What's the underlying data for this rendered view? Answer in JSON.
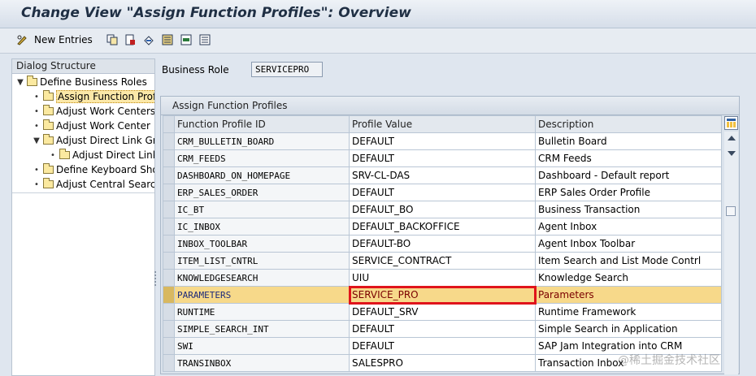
{
  "window": {
    "title": "Change View \"Assign Function Profiles\": Overview"
  },
  "toolbar": {
    "new_entries_label": "New Entries"
  },
  "dialog_structure": {
    "header": "Dialog Structure",
    "items": [
      {
        "label": "Define Business Roles",
        "level": 0,
        "expanded": true
      },
      {
        "label": "Assign Function Profi",
        "level": 1,
        "selected": true
      },
      {
        "label": "Adjust Work Centers",
        "level": 1
      },
      {
        "label": "Adjust Work Center",
        "level": 1
      },
      {
        "label": "Adjust Direct Link Gr",
        "level": 1,
        "expanded": true
      },
      {
        "label": "Adjust Direct Link",
        "level": 2
      },
      {
        "label": "Define Keyboard Sho",
        "level": 1
      },
      {
        "label": "Adjust Central Search",
        "level": 1
      }
    ]
  },
  "business_role": {
    "label": "Business Role",
    "value": "SERVICEPRO"
  },
  "table": {
    "title": "Assign Function Profiles",
    "columns": [
      "Function Profile ID",
      "Profile Value",
      "Description"
    ],
    "rows": [
      {
        "id": "CRM_BULLETIN_BOARD",
        "value": "DEFAULT",
        "description": "Bulletin Board"
      },
      {
        "id": "CRM_FEEDS",
        "value": "DEFAULT",
        "description": "CRM Feeds"
      },
      {
        "id": "DASHBOARD_ON_HOMEPAGE",
        "value": "SRV-CL-DAS",
        "description": "Dashboard - Default report"
      },
      {
        "id": "ERP_SALES_ORDER",
        "value": "DEFAULT",
        "description": "ERP Sales Order Profile"
      },
      {
        "id": "IC_BT",
        "value": "DEFAULT_BO",
        "description": "Business Transaction"
      },
      {
        "id": "IC_INBOX",
        "value": "DEFAULT_BACKOFFICE",
        "description": "Agent Inbox"
      },
      {
        "id": "INBOX_TOOLBAR",
        "value": "DEFAULT-BO",
        "description": "Agent Inbox Toolbar"
      },
      {
        "id": "ITEM_LIST_CNTRL",
        "value": "SERVICE_CONTRACT",
        "description": "Item Search and List Mode Contrl"
      },
      {
        "id": "KNOWLEDGESEARCH",
        "value": "UIU",
        "description": "Knowledge Search"
      },
      {
        "id": "PARAMETERS",
        "value": "SERVICE_PRO",
        "description": "Parameters",
        "highlighted": true
      },
      {
        "id": "RUNTIME",
        "value": "DEFAULT_SRV",
        "description": "Runtime Framework"
      },
      {
        "id": "SIMPLE_SEARCH_INT",
        "value": "DEFAULT",
        "description": "Simple Search in Application"
      },
      {
        "id": "SWI",
        "value": "DEFAULT",
        "description": "SAP Jam Integration into CRM"
      },
      {
        "id": "TRANSINBOX",
        "value": "SALESPRO",
        "description": "Transaction Inbox"
      }
    ]
  },
  "watermark": "@稀土掘金技术社区",
  "colors": {
    "highlight_row": "#f7d98a",
    "red_box": "#e0141b"
  }
}
